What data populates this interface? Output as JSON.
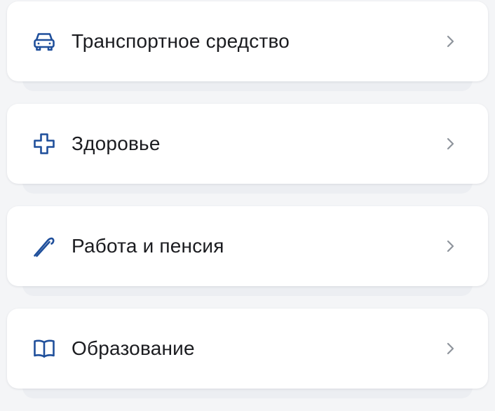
{
  "items": [
    {
      "label": "Транспортное средство",
      "icon": "car-icon"
    },
    {
      "label": "Здоровье",
      "icon": "medical-cross-icon"
    },
    {
      "label": "Работа и пенсия",
      "icon": "cane-icon"
    },
    {
      "label": "Образование",
      "icon": "open-book-icon"
    }
  ],
  "colors": {
    "icon_blue": "#1f4f9b",
    "text": "#1b1c20",
    "chevron": "#8e949c",
    "card_bg": "#ffffff",
    "page_bg": "#f4f5f7"
  }
}
